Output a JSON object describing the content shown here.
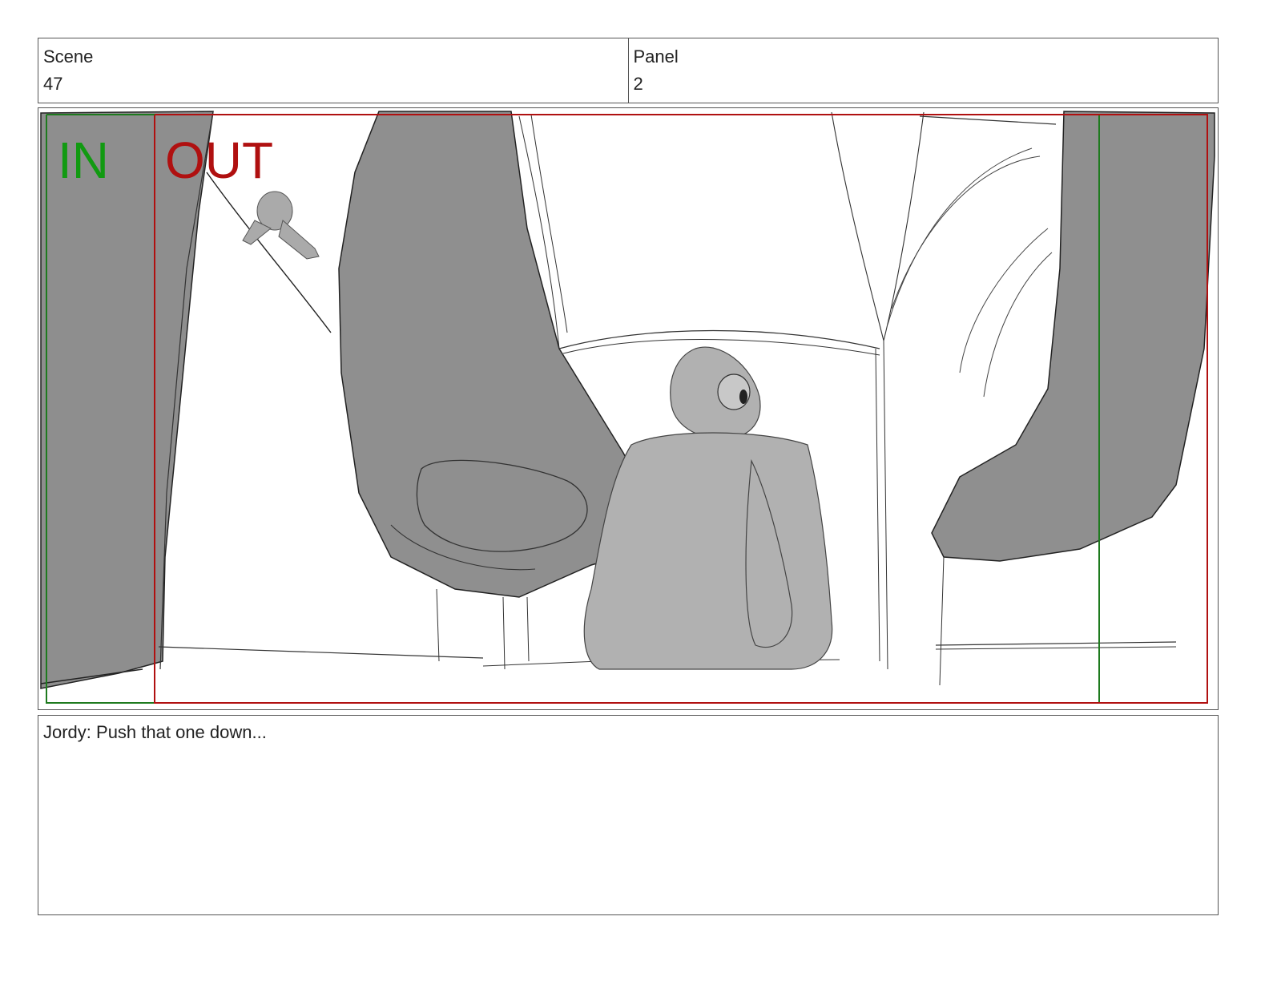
{
  "header": {
    "scene_label": "Scene",
    "scene_value": "47",
    "panel_label": "Panel",
    "panel_value": "2"
  },
  "frame": {
    "in_label": "IN",
    "out_label": "OUT",
    "in_color": "#119a11",
    "out_color": "#b01010"
  },
  "dialogue": {
    "text": "Jordy: Push that one down..."
  }
}
